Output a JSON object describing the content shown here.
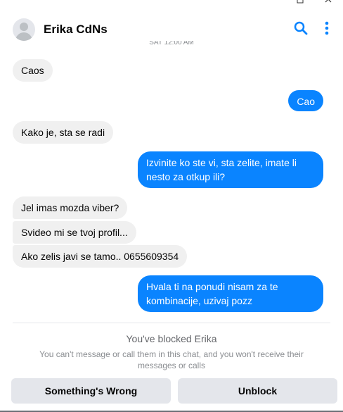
{
  "window": {
    "controls": [
      "minimize-icon",
      "close-icon"
    ]
  },
  "header": {
    "contact_name": "Erika CdNs",
    "actions": [
      "search-icon",
      "more-options-icon"
    ],
    "accent_color": "#0a84ff"
  },
  "chat": {
    "timestamp": "SAT 12:00 AM",
    "messages": [
      {
        "direction": "incoming",
        "text": "Caos"
      },
      {
        "direction": "outgoing",
        "text": "Cao"
      },
      {
        "direction": "incoming",
        "text": "Kako je, sta se radi"
      },
      {
        "direction": "outgoing",
        "text": "Izvinite ko ste vi, sta zelite, imate li nesto za otkup ili?"
      },
      {
        "direction": "incoming",
        "text": "Jel imas mozda viber?"
      },
      {
        "direction": "incoming",
        "text": "Svideo mi se tvoj profil..."
      },
      {
        "direction": "incoming",
        "text": "Ako zelis javi se tamo.. 0655609354"
      },
      {
        "direction": "outgoing",
        "text": "Hvala ti na ponudi nisam za te kombinacije, uzivaj pozz"
      }
    ]
  },
  "blocked": {
    "title": "You've blocked Erika",
    "description": "You can't message or call them in this chat, and you won't receive their messages or calls"
  },
  "actions": {
    "report_label": "Something's Wrong",
    "unblock_label": "Unblock"
  }
}
